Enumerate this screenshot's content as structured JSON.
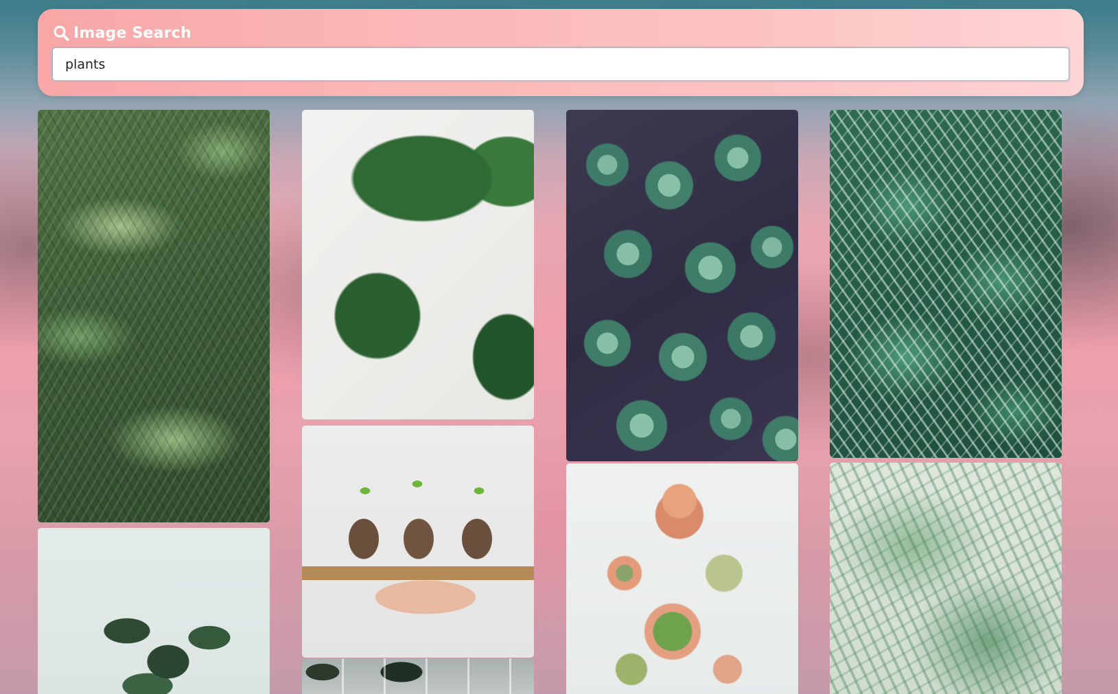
{
  "search": {
    "title": "Image Search",
    "icon": "search-icon",
    "query": "plants"
  },
  "results": [
    {
      "name": "image-result-palm-fronds",
      "column": 1
    },
    {
      "name": "image-result-fiddle-plant",
      "column": 1
    },
    {
      "name": "image-result-monstera",
      "column": 2
    },
    {
      "name": "image-result-seedlings",
      "column": 2
    },
    {
      "name": "image-result-window-plant",
      "column": 2
    },
    {
      "name": "image-result-succulents",
      "column": 3
    },
    {
      "name": "image-result-potted-succulents",
      "column": 3
    },
    {
      "name": "image-result-calathea",
      "column": 4
    },
    {
      "name": "image-result-blurred-palm",
      "column": 4
    }
  ],
  "colors": {
    "search_panel": "#fbb7b7",
    "title_text": "#ffffff",
    "input_border": "#8fb4dc"
  }
}
